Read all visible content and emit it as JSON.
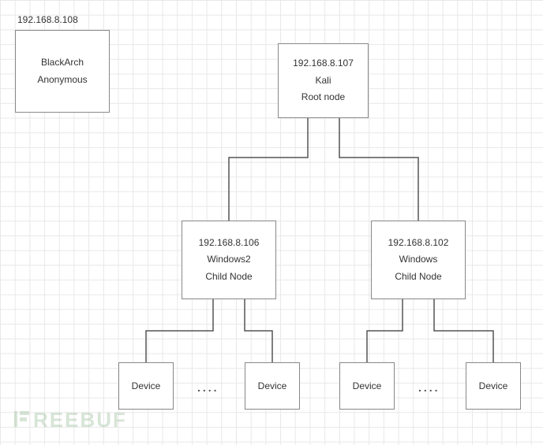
{
  "nodes": {
    "blackarch": {
      "ip": "192.168.8.108",
      "name": "BlackArch",
      "role": "Anonymous"
    },
    "root": {
      "ip": "192.168.8.107",
      "name": "Kali",
      "role": "Root node"
    },
    "child_left": {
      "ip": "192.168.8.106",
      "name": "Windows2",
      "role": "Child Node"
    },
    "child_right": {
      "ip": "192.168.8.102",
      "name": "Windows",
      "role": "Child Node"
    },
    "device_label": "Device"
  },
  "dots": "....",
  "watermark": "REEBUF"
}
